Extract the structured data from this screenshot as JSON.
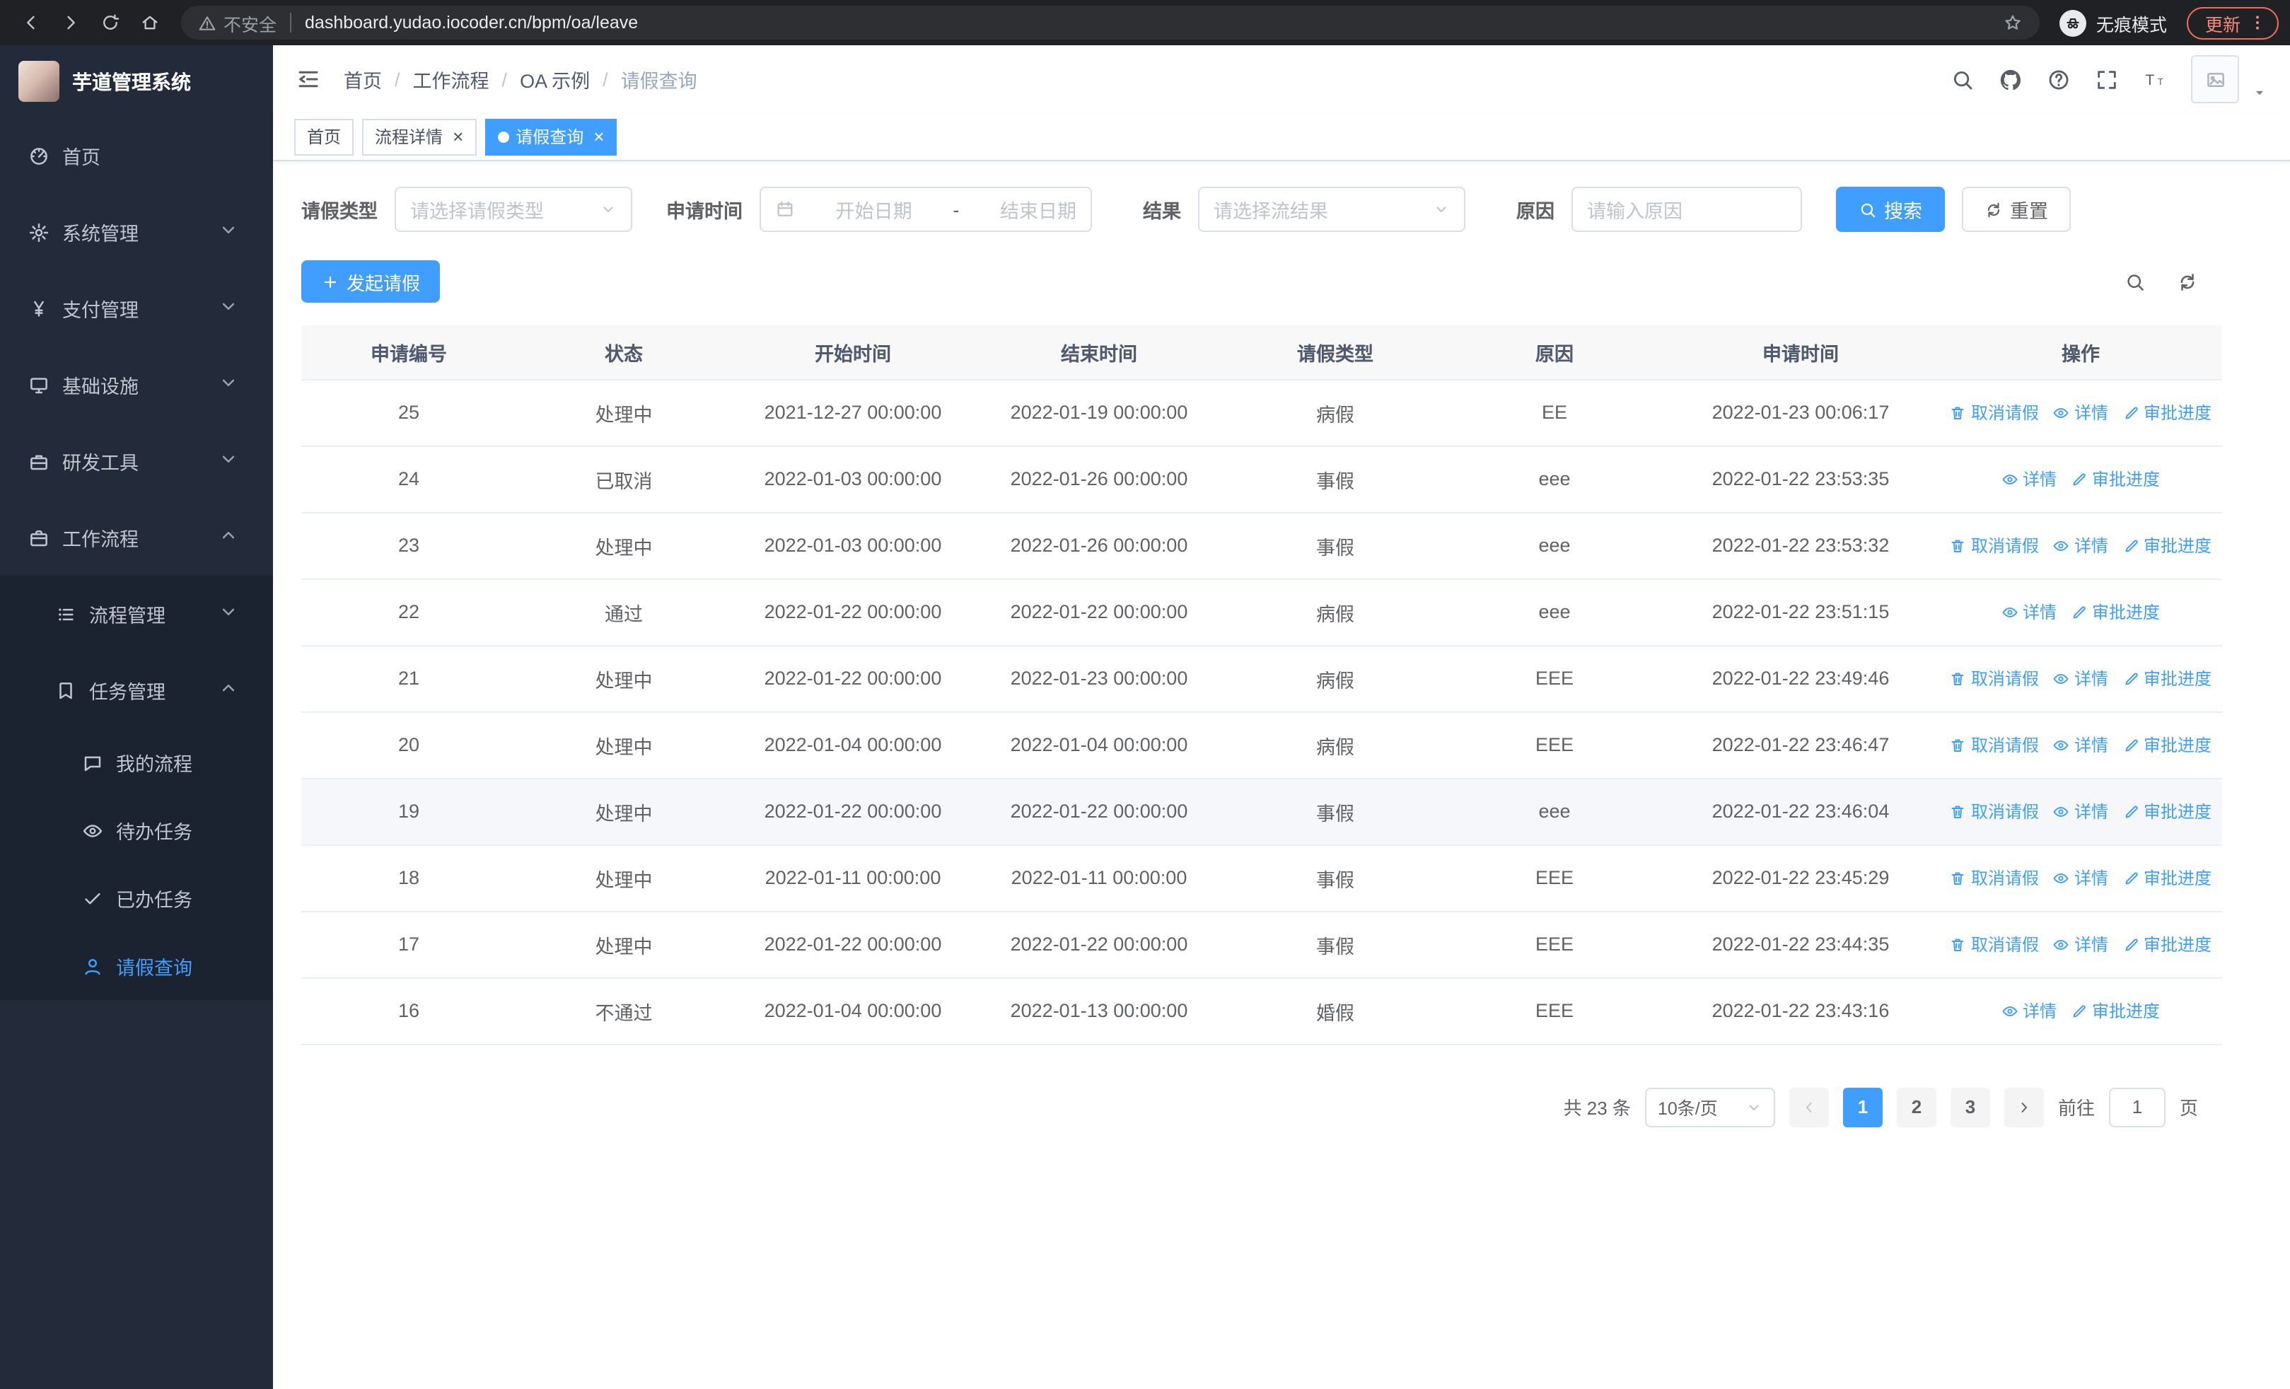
{
  "browser": {
    "nav_icons": [
      "back-icon",
      "forward-icon",
      "reload-icon",
      "home-icon"
    ],
    "security_label": "不安全",
    "url": "dashboard.yudao.iocoder.cn/bpm/oa/leave",
    "incognito_label": "无痕模式",
    "update_label": "更新"
  },
  "app_title": "芋道管理系统",
  "sidebar": {
    "items": [
      {
        "key": "home",
        "label": "首页",
        "icon": "dashboard-icon",
        "level": 1
      },
      {
        "key": "system",
        "label": "系统管理",
        "icon": "gear-icon",
        "level": 1,
        "chevron": "down"
      },
      {
        "key": "payment",
        "label": "支付管理",
        "icon": "yen-icon",
        "level": 1,
        "chevron": "down"
      },
      {
        "key": "infrastructure",
        "label": "基础设施",
        "icon": "infra-icon",
        "level": 1,
        "chevron": "down"
      },
      {
        "key": "devtools",
        "label": "研发工具",
        "icon": "tools-icon",
        "level": 1,
        "chevron": "down"
      },
      {
        "key": "workflow",
        "label": "工作流程",
        "icon": "workflow-icon",
        "level": 1,
        "chevron": "up"
      },
      {
        "key": "process-management",
        "label": "流程管理",
        "icon": "process-icon",
        "level": 2,
        "chevron": "down",
        "sub": true
      },
      {
        "key": "task-management",
        "label": "任务管理",
        "icon": "task-icon",
        "level": 2,
        "chevron": "up",
        "sub": true
      },
      {
        "key": "my-process",
        "label": "我的流程",
        "icon": "chat-icon",
        "level": 3,
        "sub": true
      },
      {
        "key": "todo-tasks",
        "label": "待办任务",
        "icon": "eye-icon",
        "level": 3,
        "sub": true
      },
      {
        "key": "done-tasks",
        "label": "已办任务",
        "icon": "done-icon",
        "level": 3,
        "sub": true
      },
      {
        "key": "leave-query",
        "label": "请假查询",
        "icon": "user-icon",
        "level": 3,
        "sub": true,
        "active": true
      }
    ]
  },
  "header": {
    "icons": [
      "search-icon",
      "github-icon",
      "help-icon",
      "fullscreen-icon",
      "font-size-icon"
    ]
  },
  "breadcrumb": [
    "首页",
    "工作流程",
    "OA 示例",
    "请假查询"
  ],
  "tabs": [
    {
      "key": "home",
      "label": "首页",
      "closable": false,
      "active": false
    },
    {
      "key": "process-detail",
      "label": "流程详情",
      "closable": true,
      "active": false
    },
    {
      "key": "leave-query",
      "label": "请假查询",
      "closable": true,
      "active": true
    }
  ],
  "filters": {
    "type_label": "请假类型",
    "type_placeholder": "请选择请假类型",
    "time_label": "申请时间",
    "start_placeholder": "开始日期",
    "range_separator": "-",
    "end_placeholder": "结束日期",
    "result_label": "结果",
    "result_placeholder": "请选择流结果",
    "reason_label": "原因",
    "reason_placeholder": "请输入原因",
    "search_label": "搜索",
    "reset_label": "重置"
  },
  "toolbar": {
    "create_label": "发起请假"
  },
  "table": {
    "columns": [
      "申请编号",
      "状态",
      "开始时间",
      "结束时间",
      "请假类型",
      "原因",
      "申请时间",
      "操作"
    ],
    "action_labels": {
      "cancel": "取消请假",
      "detail": "详情",
      "progress": "审批进度"
    },
    "action_icons": {
      "cancel": "trash-icon",
      "detail": "eye-icon",
      "progress": "edit-icon"
    },
    "rows": [
      {
        "id": "25",
        "status": "处理中",
        "start": "2021-12-27 00:00:00",
        "end": "2022-01-19 00:00:00",
        "type": "病假",
        "reason": "EE",
        "apply_time": "2022-01-23 00:06:17",
        "actions": [
          "cancel",
          "detail",
          "progress"
        ]
      },
      {
        "id": "24",
        "status": "已取消",
        "start": "2022-01-03 00:00:00",
        "end": "2022-01-26 00:00:00",
        "type": "事假",
        "reason": "eee",
        "apply_time": "2022-01-22 23:53:35",
        "actions": [
          "detail",
          "progress"
        ]
      },
      {
        "id": "23",
        "status": "处理中",
        "start": "2022-01-03 00:00:00",
        "end": "2022-01-26 00:00:00",
        "type": "事假",
        "reason": "eee",
        "apply_time": "2022-01-22 23:53:32",
        "actions": [
          "cancel",
          "detail",
          "progress"
        ]
      },
      {
        "id": "22",
        "status": "通过",
        "start": "2022-01-22 00:00:00",
        "end": "2022-01-22 00:00:00",
        "type": "病假",
        "reason": "eee",
        "apply_time": "2022-01-22 23:51:15",
        "actions": [
          "detail",
          "progress"
        ]
      },
      {
        "id": "21",
        "status": "处理中",
        "start": "2022-01-22 00:00:00",
        "end": "2022-01-23 00:00:00",
        "type": "病假",
        "reason": "EEE",
        "apply_time": "2022-01-22 23:49:46",
        "actions": [
          "cancel",
          "detail",
          "progress"
        ]
      },
      {
        "id": "20",
        "status": "处理中",
        "start": "2022-01-04 00:00:00",
        "end": "2022-01-04 00:00:00",
        "type": "病假",
        "reason": "EEE",
        "apply_time": "2022-01-22 23:46:47",
        "actions": [
          "cancel",
          "detail",
          "progress"
        ]
      },
      {
        "id": "19",
        "status": "处理中",
        "start": "2022-01-22 00:00:00",
        "end": "2022-01-22 00:00:00",
        "type": "事假",
        "reason": "eee",
        "apply_time": "2022-01-22 23:46:04",
        "actions": [
          "cancel",
          "detail",
          "progress"
        ],
        "hover": true
      },
      {
        "id": "18",
        "status": "处理中",
        "start": "2022-01-11 00:00:00",
        "end": "2022-01-11 00:00:00",
        "type": "事假",
        "reason": "EEE",
        "apply_time": "2022-01-22 23:45:29",
        "actions": [
          "cancel",
          "detail",
          "progress"
        ]
      },
      {
        "id": "17",
        "status": "处理中",
        "start": "2022-01-22 00:00:00",
        "end": "2022-01-22 00:00:00",
        "type": "事假",
        "reason": "EEE",
        "apply_time": "2022-01-22 23:44:35",
        "actions": [
          "cancel",
          "detail",
          "progress"
        ]
      },
      {
        "id": "16",
        "status": "不通过",
        "start": "2022-01-04 00:00:00",
        "end": "2022-01-13 00:00:00",
        "type": "婚假",
        "reason": "EEE",
        "apply_time": "2022-01-22 23:43:16",
        "actions": [
          "detail",
          "progress"
        ]
      }
    ]
  },
  "pagination": {
    "total_label": "共 23 条",
    "page_size": "10条/页",
    "pages": [
      "1",
      "2",
      "3"
    ],
    "active_page": "1",
    "goto_label": "前往",
    "goto_value": "1",
    "goto_suffix": "页"
  },
  "colors": {
    "primary": "#409eff"
  }
}
